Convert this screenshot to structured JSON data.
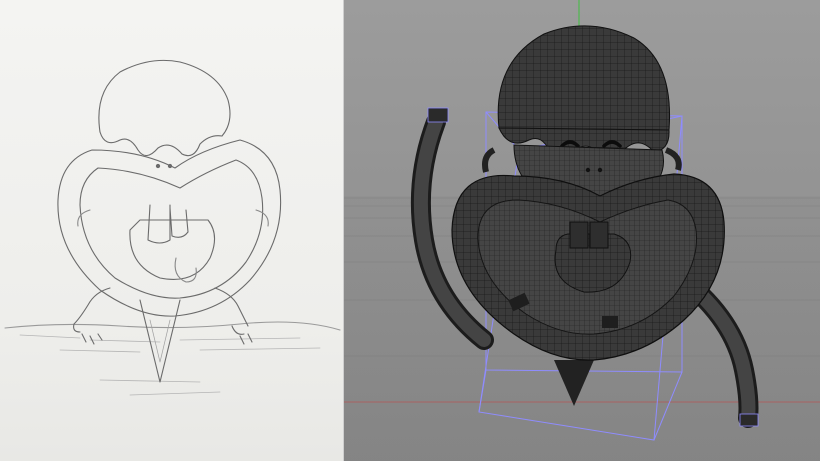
{
  "sketch": {
    "stroke_color": "#6b6b6b",
    "paper_color": "#f2f2f0"
  },
  "viewport": {
    "background_color": "#949494",
    "mesh_fill": "#3a3a3a",
    "mesh_line": "#1a1a1a",
    "bbox_color": "#8f8cff",
    "axis_y_color": "#3fbf3f",
    "axis_x_color": "#c84040"
  }
}
